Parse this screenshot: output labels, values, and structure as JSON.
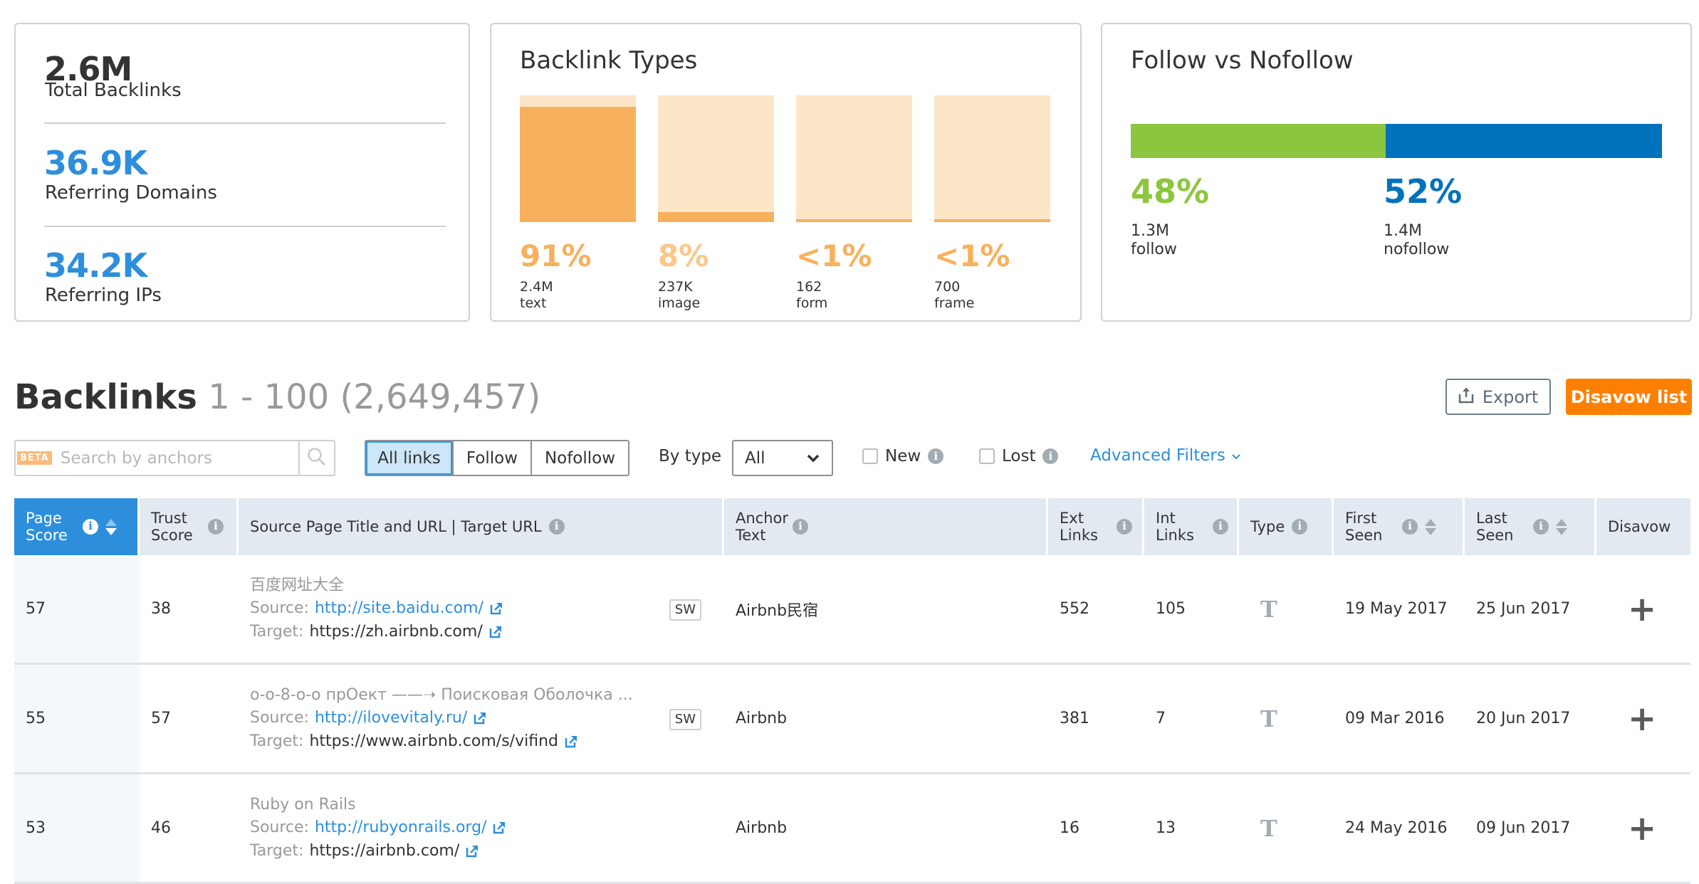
{
  "summary": {
    "total_backlinks": {
      "value": "2.6M",
      "label": "Total Backlinks",
      "color": "#333333"
    },
    "referring_domains": {
      "value": "36.9K",
      "label": "Referring Domains",
      "color": "#2d8fdc"
    },
    "referring_ips": {
      "value": "34.2K",
      "label": "Referring IPs",
      "color": "#2d8fdc"
    }
  },
  "backlink_types": {
    "title": "Backlink Types",
    "items": [
      {
        "pct_label": "91%",
        "share": 0.91,
        "count": "2.4M",
        "name": "text"
      },
      {
        "pct_label": "8%",
        "share": 0.08,
        "count": "237K",
        "name": "image"
      },
      {
        "pct_label": "<1%",
        "share": 0.005,
        "count": "162",
        "name": "form"
      },
      {
        "pct_label": "<1%",
        "share": 0.005,
        "count": "700",
        "name": "frame"
      }
    ],
    "fill_color": "#f7b15c",
    "track_color": "#fde5c8"
  },
  "follow_vs_nofollow": {
    "title": "Follow vs Nofollow",
    "items": [
      {
        "pct_label": "48%",
        "share": 0.48,
        "count": "1.3M",
        "name": "follow",
        "color": "#8cc63e"
      },
      {
        "pct_label": "52%",
        "share": 0.52,
        "count": "1.4M",
        "name": "nofollow",
        "color": "#0072bc"
      }
    ]
  },
  "backlinks": {
    "title": "Backlinks",
    "range": "1 - 100 (2,649,457)",
    "export_label": "Export",
    "disavow_list_label": "Disavow list"
  },
  "filters": {
    "beta_badge": "BETA",
    "search_placeholder": "Search by anchors",
    "search_value": "",
    "link_filters": [
      {
        "label": "All links",
        "active": true
      },
      {
        "label": "Follow",
        "active": false
      },
      {
        "label": "Nofollow",
        "active": false
      }
    ],
    "by_type_label": "By type",
    "by_type_value": "All",
    "new_label": "New",
    "new_checked": false,
    "lost_label": "Lost",
    "lost_checked": false,
    "advanced_filters_label": "Advanced Filters"
  },
  "table": {
    "columns": [
      {
        "key": "page_score",
        "label": "Page Score",
        "info": true,
        "sortable": true,
        "sorted": true
      },
      {
        "key": "trust_score",
        "label": "Trust Score",
        "info": true
      },
      {
        "key": "source",
        "label": "Source Page Title and URL | Target URL",
        "info": true
      },
      {
        "key": "anchor",
        "label": "Anchor Text",
        "info": true
      },
      {
        "key": "ext_links",
        "label": "Ext Links",
        "info": true
      },
      {
        "key": "int_links",
        "label": "Int Links",
        "info": true
      },
      {
        "key": "type",
        "label": "Type",
        "info": true
      },
      {
        "key": "first_seen",
        "label": "First Seen",
        "info": true,
        "sortable": true
      },
      {
        "key": "last_seen",
        "label": "Last Seen",
        "info": true,
        "sortable": true
      },
      {
        "key": "disavow",
        "label": "Disavow"
      }
    ],
    "source_label": "Source:",
    "target_label": "Target:",
    "sw_label": "SW",
    "type_glyph": "T",
    "disavow_glyph": "+",
    "rows": [
      {
        "page_score": "57",
        "trust_score": "38",
        "title": "百度网址大全",
        "source_url": "http://site.baidu.com/",
        "target_url": "https://zh.airbnb.com/",
        "sw": true,
        "anchor": "Airbnb民宿",
        "ext_links": "552",
        "int_links": "105",
        "type": "text",
        "first_seen": "19 May 2017",
        "last_seen": "25 Jun 2017"
      },
      {
        "page_score": "55",
        "trust_score": "57",
        "title": "о-о-8-о-о прОект ——➝ Поисковая Оболочка ...",
        "source_url": "http://ilovevitaly.ru/",
        "target_url": "https://www.airbnb.com/s/vifind",
        "sw": true,
        "anchor": "Airbnb",
        "ext_links": "381",
        "int_links": "7",
        "type": "text",
        "first_seen": "09 Mar 2016",
        "last_seen": "20 Jun 2017"
      },
      {
        "page_score": "53",
        "trust_score": "46",
        "title": "Ruby on Rails",
        "source_url": "http://rubyonrails.org/",
        "target_url": "https://airbnb.com/",
        "sw": false,
        "anchor": "Airbnb",
        "ext_links": "16",
        "int_links": "13",
        "type": "text",
        "first_seen": "24 May 2016",
        "last_seen": "09 Jun 2017"
      }
    ]
  },
  "icons": {
    "info": "info-icon",
    "search": "search-icon",
    "export": "upload-icon",
    "external_link": "external-link-icon",
    "chevron": "chevron-down-icon",
    "sort": "sort-arrows-icon",
    "type_text": "text-type-icon",
    "disavow": "plus-icon"
  }
}
